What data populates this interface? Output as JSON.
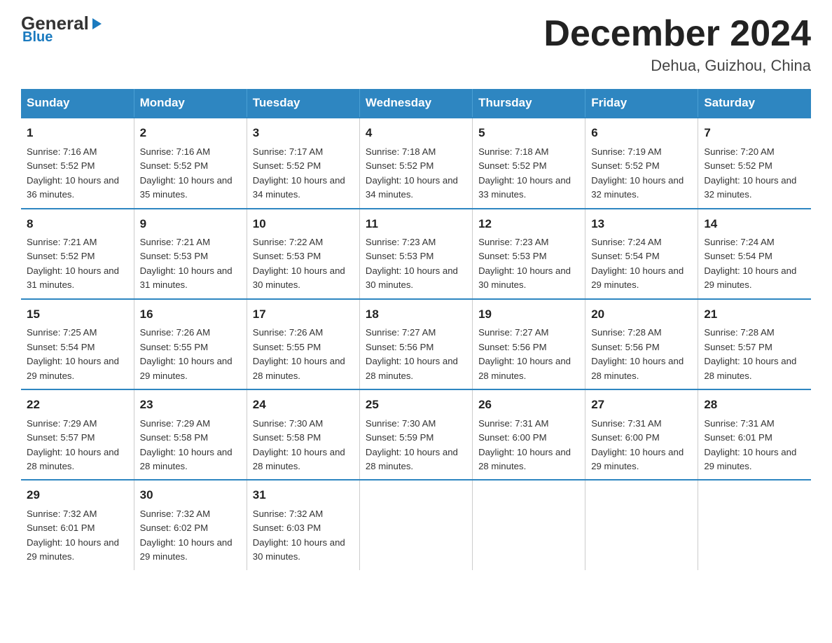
{
  "header": {
    "logo_text": "General",
    "logo_blue": "Blue",
    "title": "December 2024",
    "subtitle": "Dehua, Guizhou, China"
  },
  "days_of_week": [
    "Sunday",
    "Monday",
    "Tuesday",
    "Wednesday",
    "Thursday",
    "Friday",
    "Saturday"
  ],
  "weeks": [
    [
      {
        "num": "1",
        "sunrise": "7:16 AM",
        "sunset": "5:52 PM",
        "daylight": "10 hours and 36 minutes."
      },
      {
        "num": "2",
        "sunrise": "7:16 AM",
        "sunset": "5:52 PM",
        "daylight": "10 hours and 35 minutes."
      },
      {
        "num": "3",
        "sunrise": "7:17 AM",
        "sunset": "5:52 PM",
        "daylight": "10 hours and 34 minutes."
      },
      {
        "num": "4",
        "sunrise": "7:18 AM",
        "sunset": "5:52 PM",
        "daylight": "10 hours and 34 minutes."
      },
      {
        "num": "5",
        "sunrise": "7:18 AM",
        "sunset": "5:52 PM",
        "daylight": "10 hours and 33 minutes."
      },
      {
        "num": "6",
        "sunrise": "7:19 AM",
        "sunset": "5:52 PM",
        "daylight": "10 hours and 32 minutes."
      },
      {
        "num": "7",
        "sunrise": "7:20 AM",
        "sunset": "5:52 PM",
        "daylight": "10 hours and 32 minutes."
      }
    ],
    [
      {
        "num": "8",
        "sunrise": "7:21 AM",
        "sunset": "5:52 PM",
        "daylight": "10 hours and 31 minutes."
      },
      {
        "num": "9",
        "sunrise": "7:21 AM",
        "sunset": "5:53 PM",
        "daylight": "10 hours and 31 minutes."
      },
      {
        "num": "10",
        "sunrise": "7:22 AM",
        "sunset": "5:53 PM",
        "daylight": "10 hours and 30 minutes."
      },
      {
        "num": "11",
        "sunrise": "7:23 AM",
        "sunset": "5:53 PM",
        "daylight": "10 hours and 30 minutes."
      },
      {
        "num": "12",
        "sunrise": "7:23 AM",
        "sunset": "5:53 PM",
        "daylight": "10 hours and 30 minutes."
      },
      {
        "num": "13",
        "sunrise": "7:24 AM",
        "sunset": "5:54 PM",
        "daylight": "10 hours and 29 minutes."
      },
      {
        "num": "14",
        "sunrise": "7:24 AM",
        "sunset": "5:54 PM",
        "daylight": "10 hours and 29 minutes."
      }
    ],
    [
      {
        "num": "15",
        "sunrise": "7:25 AM",
        "sunset": "5:54 PM",
        "daylight": "10 hours and 29 minutes."
      },
      {
        "num": "16",
        "sunrise": "7:26 AM",
        "sunset": "5:55 PM",
        "daylight": "10 hours and 29 minutes."
      },
      {
        "num": "17",
        "sunrise": "7:26 AM",
        "sunset": "5:55 PM",
        "daylight": "10 hours and 28 minutes."
      },
      {
        "num": "18",
        "sunrise": "7:27 AM",
        "sunset": "5:56 PM",
        "daylight": "10 hours and 28 minutes."
      },
      {
        "num": "19",
        "sunrise": "7:27 AM",
        "sunset": "5:56 PM",
        "daylight": "10 hours and 28 minutes."
      },
      {
        "num": "20",
        "sunrise": "7:28 AM",
        "sunset": "5:56 PM",
        "daylight": "10 hours and 28 minutes."
      },
      {
        "num": "21",
        "sunrise": "7:28 AM",
        "sunset": "5:57 PM",
        "daylight": "10 hours and 28 minutes."
      }
    ],
    [
      {
        "num": "22",
        "sunrise": "7:29 AM",
        "sunset": "5:57 PM",
        "daylight": "10 hours and 28 minutes."
      },
      {
        "num": "23",
        "sunrise": "7:29 AM",
        "sunset": "5:58 PM",
        "daylight": "10 hours and 28 minutes."
      },
      {
        "num": "24",
        "sunrise": "7:30 AM",
        "sunset": "5:58 PM",
        "daylight": "10 hours and 28 minutes."
      },
      {
        "num": "25",
        "sunrise": "7:30 AM",
        "sunset": "5:59 PM",
        "daylight": "10 hours and 28 minutes."
      },
      {
        "num": "26",
        "sunrise": "7:31 AM",
        "sunset": "6:00 PM",
        "daylight": "10 hours and 28 minutes."
      },
      {
        "num": "27",
        "sunrise": "7:31 AM",
        "sunset": "6:00 PM",
        "daylight": "10 hours and 29 minutes."
      },
      {
        "num": "28",
        "sunrise": "7:31 AM",
        "sunset": "6:01 PM",
        "daylight": "10 hours and 29 minutes."
      }
    ],
    [
      {
        "num": "29",
        "sunrise": "7:32 AM",
        "sunset": "6:01 PM",
        "daylight": "10 hours and 29 minutes."
      },
      {
        "num": "30",
        "sunrise": "7:32 AM",
        "sunset": "6:02 PM",
        "daylight": "10 hours and 29 minutes."
      },
      {
        "num": "31",
        "sunrise": "7:32 AM",
        "sunset": "6:03 PM",
        "daylight": "10 hours and 30 minutes."
      },
      null,
      null,
      null,
      null
    ]
  ]
}
